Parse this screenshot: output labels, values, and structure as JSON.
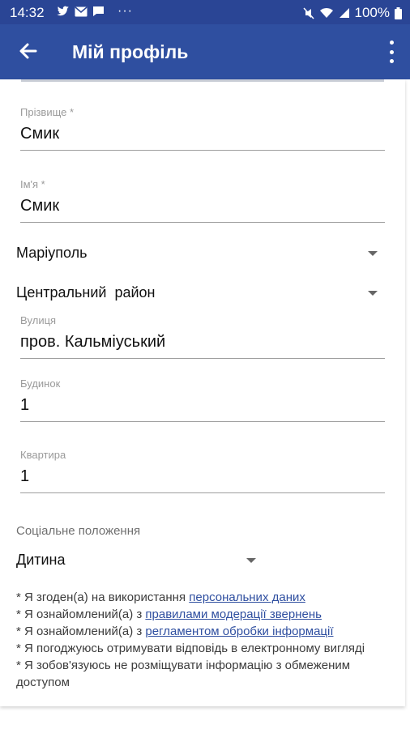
{
  "status_bar": {
    "time": "14:32",
    "battery": "100%",
    "icons": [
      "twitter-icon",
      "mail-icon",
      "message-icon",
      "more-icon",
      "mute-icon",
      "wifi-icon",
      "signal-icon",
      "battery-icon"
    ]
  },
  "app_bar": {
    "title": "Мій профіль",
    "back_icon": "arrow-left-icon",
    "menu_icon": "more-vertical-icon"
  },
  "form": {
    "surname": {
      "label": "Прізвище *",
      "value": "Смик"
    },
    "first_name": {
      "label": "Ім'я *",
      "value": "Смик"
    },
    "city": {
      "value": "Маріуполь"
    },
    "district": {
      "value": "Центральний  район"
    },
    "street": {
      "label": "Вулиця",
      "value": "пров. Кальміуський"
    },
    "house": {
      "label": "Будинок",
      "value": "1"
    },
    "apartment": {
      "label": "Квартира",
      "value": "1"
    },
    "social_status": {
      "label": "Соціальне положення",
      "value": "Дитина"
    }
  },
  "agreements": {
    "line1_text": "* Я згоден(а) на використання ",
    "line1_link": "персональних даних",
    "line2_text": "* Я ознайомлений(а) з ",
    "line2_link": "правилами модерації звернень",
    "line3_text": "* Я ознайомлений(а) з ",
    "line3_link": "регламентом обробки інформації",
    "line4_text": "* Я погоджуюсь отримувати відповідь в електронному вигляді",
    "line5_text": "* Я зобов'язуюсь не розміщувати інформацію з обмеженим доступом"
  },
  "colors": {
    "primary": "#2f4fa0",
    "statusbar": "#2a4595",
    "link": "#2f4fa0"
  }
}
